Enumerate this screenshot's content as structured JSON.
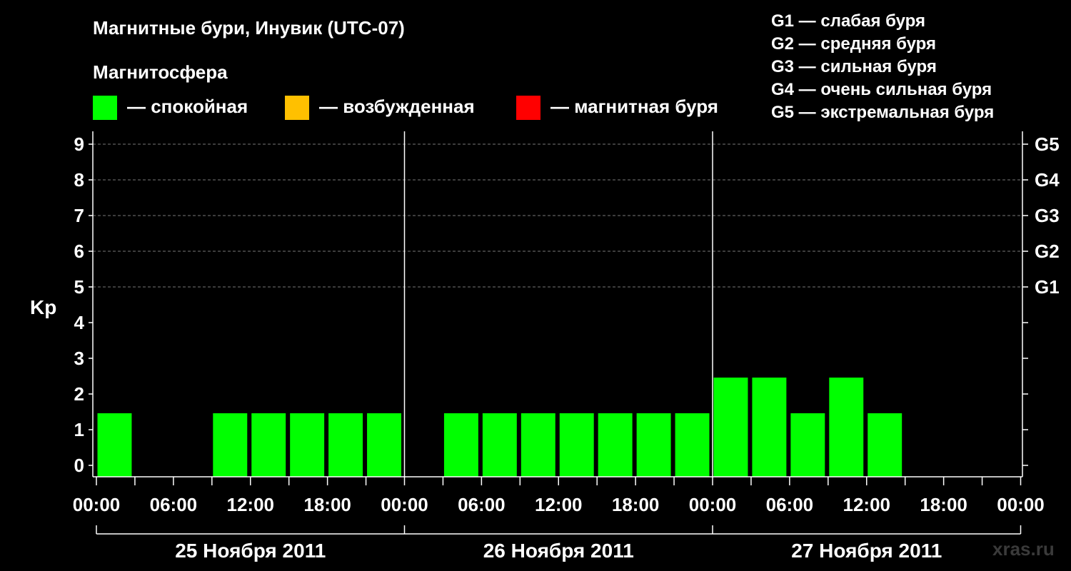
{
  "header": {
    "title": "Магнитные бури, Инувик (UTC-07)",
    "subtitle": "Магнитосфера"
  },
  "legend": [
    {
      "label": "— спокойная",
      "color": "#00ff00"
    },
    {
      "label": "— возбужденная",
      "color": "#ffc000"
    },
    {
      "label": "— магнитная буря",
      "color": "#ff0000"
    }
  ],
  "storm_scale": [
    "G1 — слабая буря",
    "G2 — средняя буря",
    "G3 — сильная буря",
    "G4 — очень сильная буря",
    "G5 — экстремальная буря"
  ],
  "watermark": "xras.ru",
  "chart_data": {
    "type": "bar",
    "title": "Магнитные бури, Инувик (UTC-07)",
    "ylabel": "Kp",
    "ylim": [
      0,
      9
    ],
    "y_ticks": [
      0,
      1,
      2,
      3,
      4,
      5,
      6,
      7,
      8,
      9
    ],
    "grid": "dashed horizontal at Kp 5-9",
    "right_axis_labels": [
      {
        "kp": 5,
        "label": "G1"
      },
      {
        "kp": 6,
        "label": "G2"
      },
      {
        "kp": 7,
        "label": "G3"
      },
      {
        "kp": 8,
        "label": "G4"
      },
      {
        "kp": 9,
        "label": "G5"
      }
    ],
    "x_tick_labels": [
      "00:00",
      "06:00",
      "12:00",
      "18:00",
      "00:00",
      "06:00",
      "12:00",
      "18:00",
      "00:00",
      "06:00",
      "12:00",
      "18:00",
      "00:00"
    ],
    "days": [
      "25 Ноября 2011",
      "26 Ноября 2011",
      "27 Ноября 2011"
    ],
    "interval_hours": 3,
    "values": [
      [
        1,
        null,
        null,
        1,
        1,
        1,
        1,
        1
      ],
      [
        null,
        1,
        1,
        1,
        1,
        1,
        1,
        1
      ],
      [
        2,
        2,
        1,
        2,
        1,
        null,
        null,
        null
      ]
    ],
    "colors": {
      "quiet": "#00ff00",
      "active": "#ffc000",
      "storm": "#ff0000"
    }
  }
}
